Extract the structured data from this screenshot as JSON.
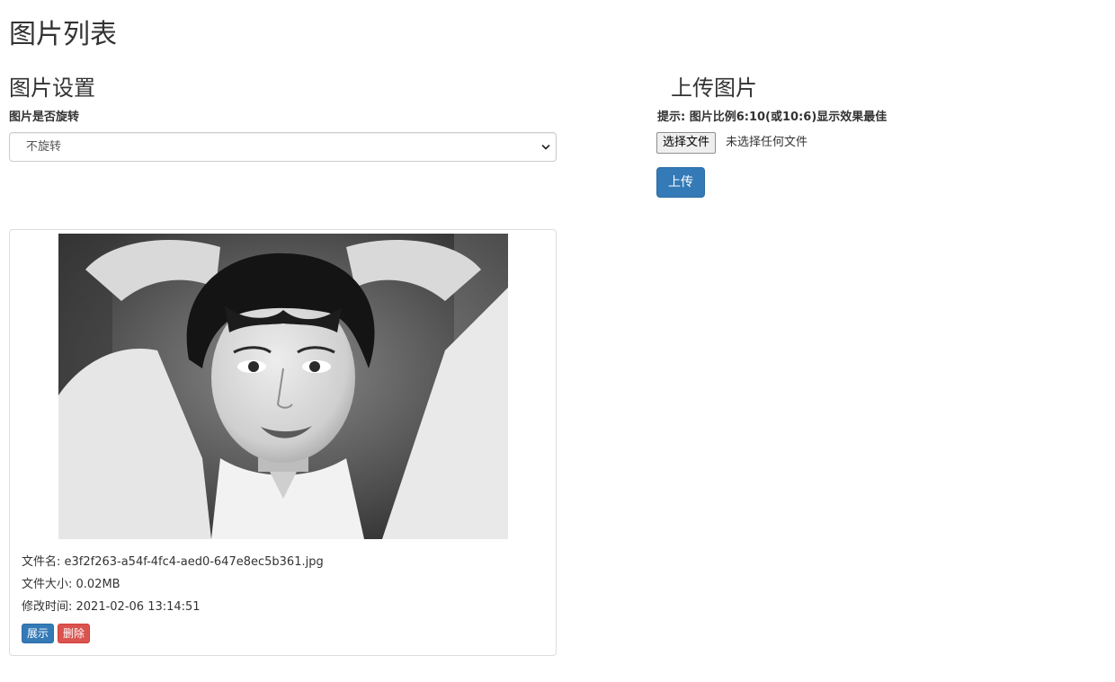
{
  "page": {
    "title": "图片列表"
  },
  "settings": {
    "heading": "图片设置",
    "rotate_label": "图片是否旋转",
    "rotate_selected": "不旋转"
  },
  "upload": {
    "heading": "上传图片",
    "hint": "提示: 图片比例6:10(或10:6)显示效果最佳",
    "file_button_label": "选择文件",
    "file_status": "未选择任何文件",
    "submit_label": "上传"
  },
  "images": [
    {
      "filename_line": "文件名: e3f2f263-a54f-4fc4-aed0-647e8ec5b361.jpg",
      "size_line": "文件大小: 0.02MB",
      "modified_line": "修改时间: 2021-02-06 13:14:51",
      "show_label": "展示",
      "delete_label": "删除"
    }
  ],
  "icons": {
    "select_chevron": "chevron-down-icon"
  },
  "colors": {
    "primary": "#337ab7",
    "danger": "#d9534f",
    "text": "#333333",
    "border": "#dddddd"
  }
}
